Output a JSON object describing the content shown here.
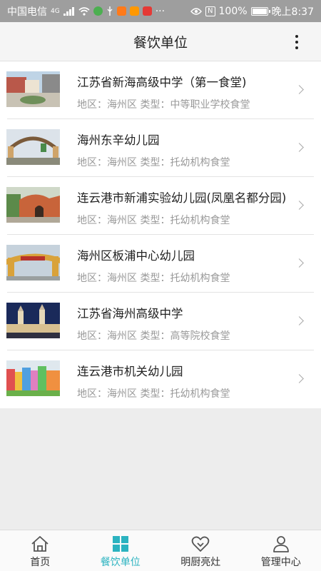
{
  "status_bar": {
    "carrier": "中国电信",
    "network": "4G",
    "battery": "100%",
    "time": "晚上8:37",
    "more": "···",
    "nfc": "N"
  },
  "header": {
    "title": "餐饮单位",
    "more_icon": "more-vertical-icon"
  },
  "list": {
    "items": [
      {
        "name": "江苏省新海高级中学（第一食堂)",
        "region_label": "地区：",
        "region": "海州区",
        "type_label": "类型：",
        "type": "中等职业学校食堂"
      },
      {
        "name": "海州东辛幼儿园",
        "region_label": "地区：",
        "region": "海州区",
        "type_label": "类型：",
        "type": "托幼机构食堂"
      },
      {
        "name": "连云港市新浦实验幼儿园(凤凰名都分园)",
        "region_label": "地区：",
        "region": "海州区",
        "type_label": "类型：",
        "type": "托幼机构食堂"
      },
      {
        "name": "海州区板浦中心幼儿园",
        "region_label": "地区：",
        "region": "海州区",
        "type_label": "类型：",
        "type": "托幼机构食堂"
      },
      {
        "name": "江苏省海州高级中学",
        "region_label": "地区：",
        "region": "海州区",
        "type_label": "类型：",
        "type": "高等院校食堂"
      },
      {
        "name": "连云港市机关幼儿园",
        "region_label": "地区：",
        "region": "海州区",
        "type_label": "类型：",
        "type": "托幼机构食堂"
      }
    ]
  },
  "tab_bar": {
    "tabs": [
      {
        "label": "首页",
        "icon": "home-icon",
        "active": false
      },
      {
        "label": "餐饮单位",
        "icon": "grid-icon",
        "active": true
      },
      {
        "label": "明厨亮灶",
        "icon": "heart-icon",
        "active": false
      },
      {
        "label": "管理中心",
        "icon": "user-icon",
        "active": false
      }
    ]
  },
  "colors": {
    "accent": "#2bb3c0",
    "status_bar": "#9e9e9e",
    "meta_text": "#999999"
  }
}
